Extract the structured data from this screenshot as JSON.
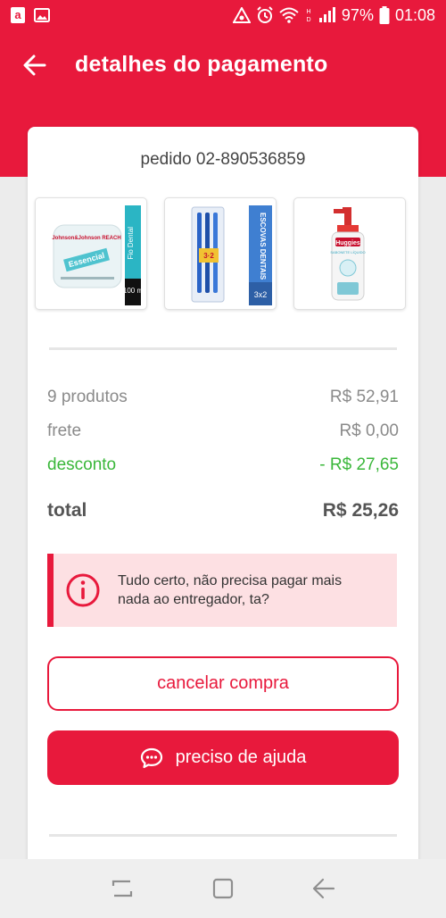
{
  "status_bar": {
    "battery": "97%",
    "time": "01:08"
  },
  "header": {
    "title": "detalhes do pagamento"
  },
  "order": {
    "id_label": "pedido 02-890536859",
    "products": [
      {
        "name": "Fio Dental Johnson's Reach Essencial 100 m",
        "box_text": "Fio Dental",
        "size_text": "100 m",
        "brand_text": "Johnson&Johnson REACH",
        "product_text": "Essencial"
      },
      {
        "name": "Escovas Dentais Oral-B 3x2",
        "box_text": "ESCOVAS DENTAIS",
        "size_text": "3x2",
        "promo_text": "3·2"
      },
      {
        "name": "Sabonete Líquido Huggies",
        "brand_text": "Huggies",
        "product_text": "SABONETE LÍQUIDO"
      }
    ]
  },
  "summary": {
    "products_label": "9 produtos",
    "products_value": "R$ 52,91",
    "shipping_label": "frete",
    "shipping_value": "R$ 0,00",
    "discount_label": "desconto",
    "discount_value": "- R$ 27,65",
    "total_label": "total",
    "total_value": "R$ 25,26"
  },
  "alert": {
    "message": "Tudo certo, não precisa pagar mais nada ao entregador, ta?"
  },
  "actions": {
    "cancel_label": "cancelar compra",
    "help_label": "preciso de ajuda"
  },
  "colors": {
    "brand": "#e8193c",
    "discount": "#3ab73a",
    "alert_bg": "#fde0e3"
  },
  "icons": {
    "back": "arrow-left-icon",
    "info": "info-circle-icon",
    "chat": "chat-bubble-icon"
  }
}
